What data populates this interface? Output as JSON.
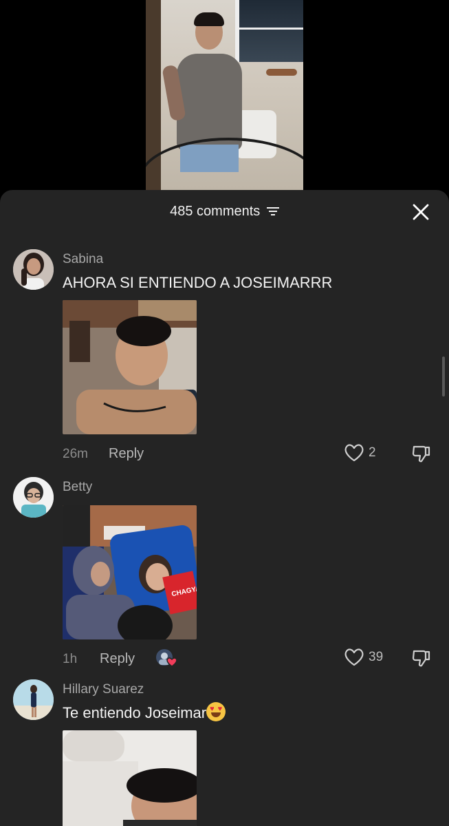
{
  "header": {
    "comments_label": "485 comments"
  },
  "comments": [
    {
      "user": "Sabina",
      "text": "AHORA SI ENTIENDO A JOSEIMARRR",
      "time": "26m",
      "reply_label": "Reply",
      "likes": "2"
    },
    {
      "user": "Betty",
      "text": "",
      "time": "1h",
      "reply_label": "Reply",
      "likes": "39",
      "thumb_shirt_text": "CHAGYA"
    },
    {
      "user": "Hillary Suarez",
      "text": "Te entiendo Joseimar"
    }
  ],
  "icons": {
    "filter": "filter-icon",
    "close": "close-icon",
    "heart": "heart-icon",
    "dislike": "thumbs-down-icon",
    "emoji": "heart-eyes-emoji"
  },
  "colors": {
    "sheet_bg": "#242424",
    "text_primary": "#f4f4f4",
    "text_secondary": "#a8a8a8"
  }
}
